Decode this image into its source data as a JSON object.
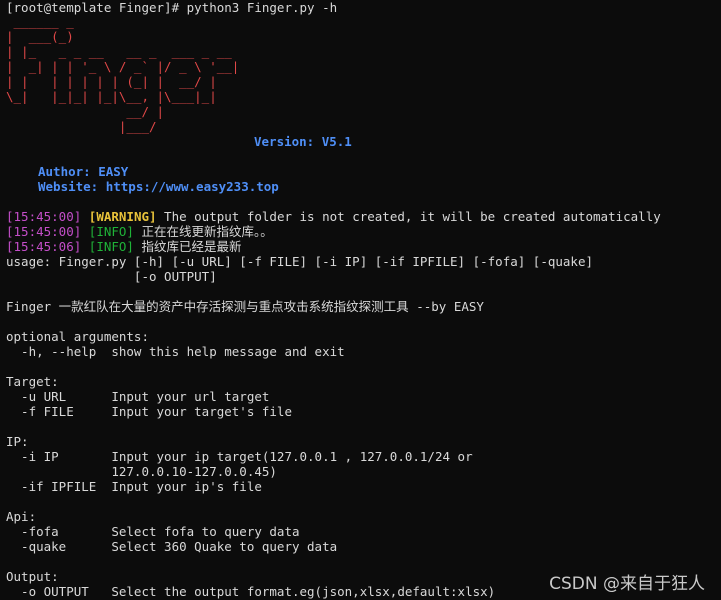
{
  "terminal": {
    "prompt_line": "[root@template Finger]# python3 Finger.py -h",
    "banner": {
      "art": " ______ _\n|  ___(_)\n| |_   _ _ __   __ _  ___ _ __\n|  _| | | '_ \\ / _` |/ _ \\ '__|\n| |   | | | | | (_| |  __/ |\n\\_|   |_|_| |_|\\__, |\\___|_|\n                __/ |\n               |___/",
      "version": "Version: V5.1",
      "author": "Author: EASY",
      "website": "Website: https://www.easy233.top"
    },
    "logs": [
      {
        "time": "[15:45:00]",
        "level": "[WARNING]",
        "message": " The output folder is not created, it will be created automatically"
      },
      {
        "time": "[15:45:00]",
        "level": "[INFO]",
        "message": " 正在在线更新指纹库。。"
      },
      {
        "time": "[15:45:06]",
        "level": "[INFO]",
        "message": " 指纹库已经是最新"
      }
    ],
    "usage": [
      "usage: Finger.py [-h] [-u URL] [-f FILE] [-i IP] [-if IPFILE] [-fofa] [-quake]",
      "                 [-o OUTPUT]"
    ],
    "description": "Finger 一款红队在大量的资产中存活探测与重点攻击系统指纹探测工具 --by EASY",
    "help": [
      "optional arguments:",
      "  -h, --help  show this help message and exit",
      "Target:",
      "  -u URL      Input your url target",
      "  -f FILE     Input your target's file",
      "IP:",
      "  -i IP       Input your ip target(127.0.0.1 , 127.0.0.1/24 or",
      "              127.0.0.10-127.0.0.45)",
      "  -if IPFILE  Input your ip's file",
      "Api:",
      "  -fofa       Select fofa to query data",
      "  -quake      Select 360 Quake to query data",
      "Output:",
      "  -o OUTPUT   Select the output format.eg(json,xlsx,default:xlsx)"
    ]
  },
  "watermark": "CSDN @来自于狂人",
  "colors": {
    "background": "#0c0c0c",
    "banner_red": "#e04848",
    "blue": "#4f8ff7",
    "timestamp_magenta": "#c44ec9",
    "warning_yellow": "#e8c23a",
    "info_green": "#1fb338"
  }
}
